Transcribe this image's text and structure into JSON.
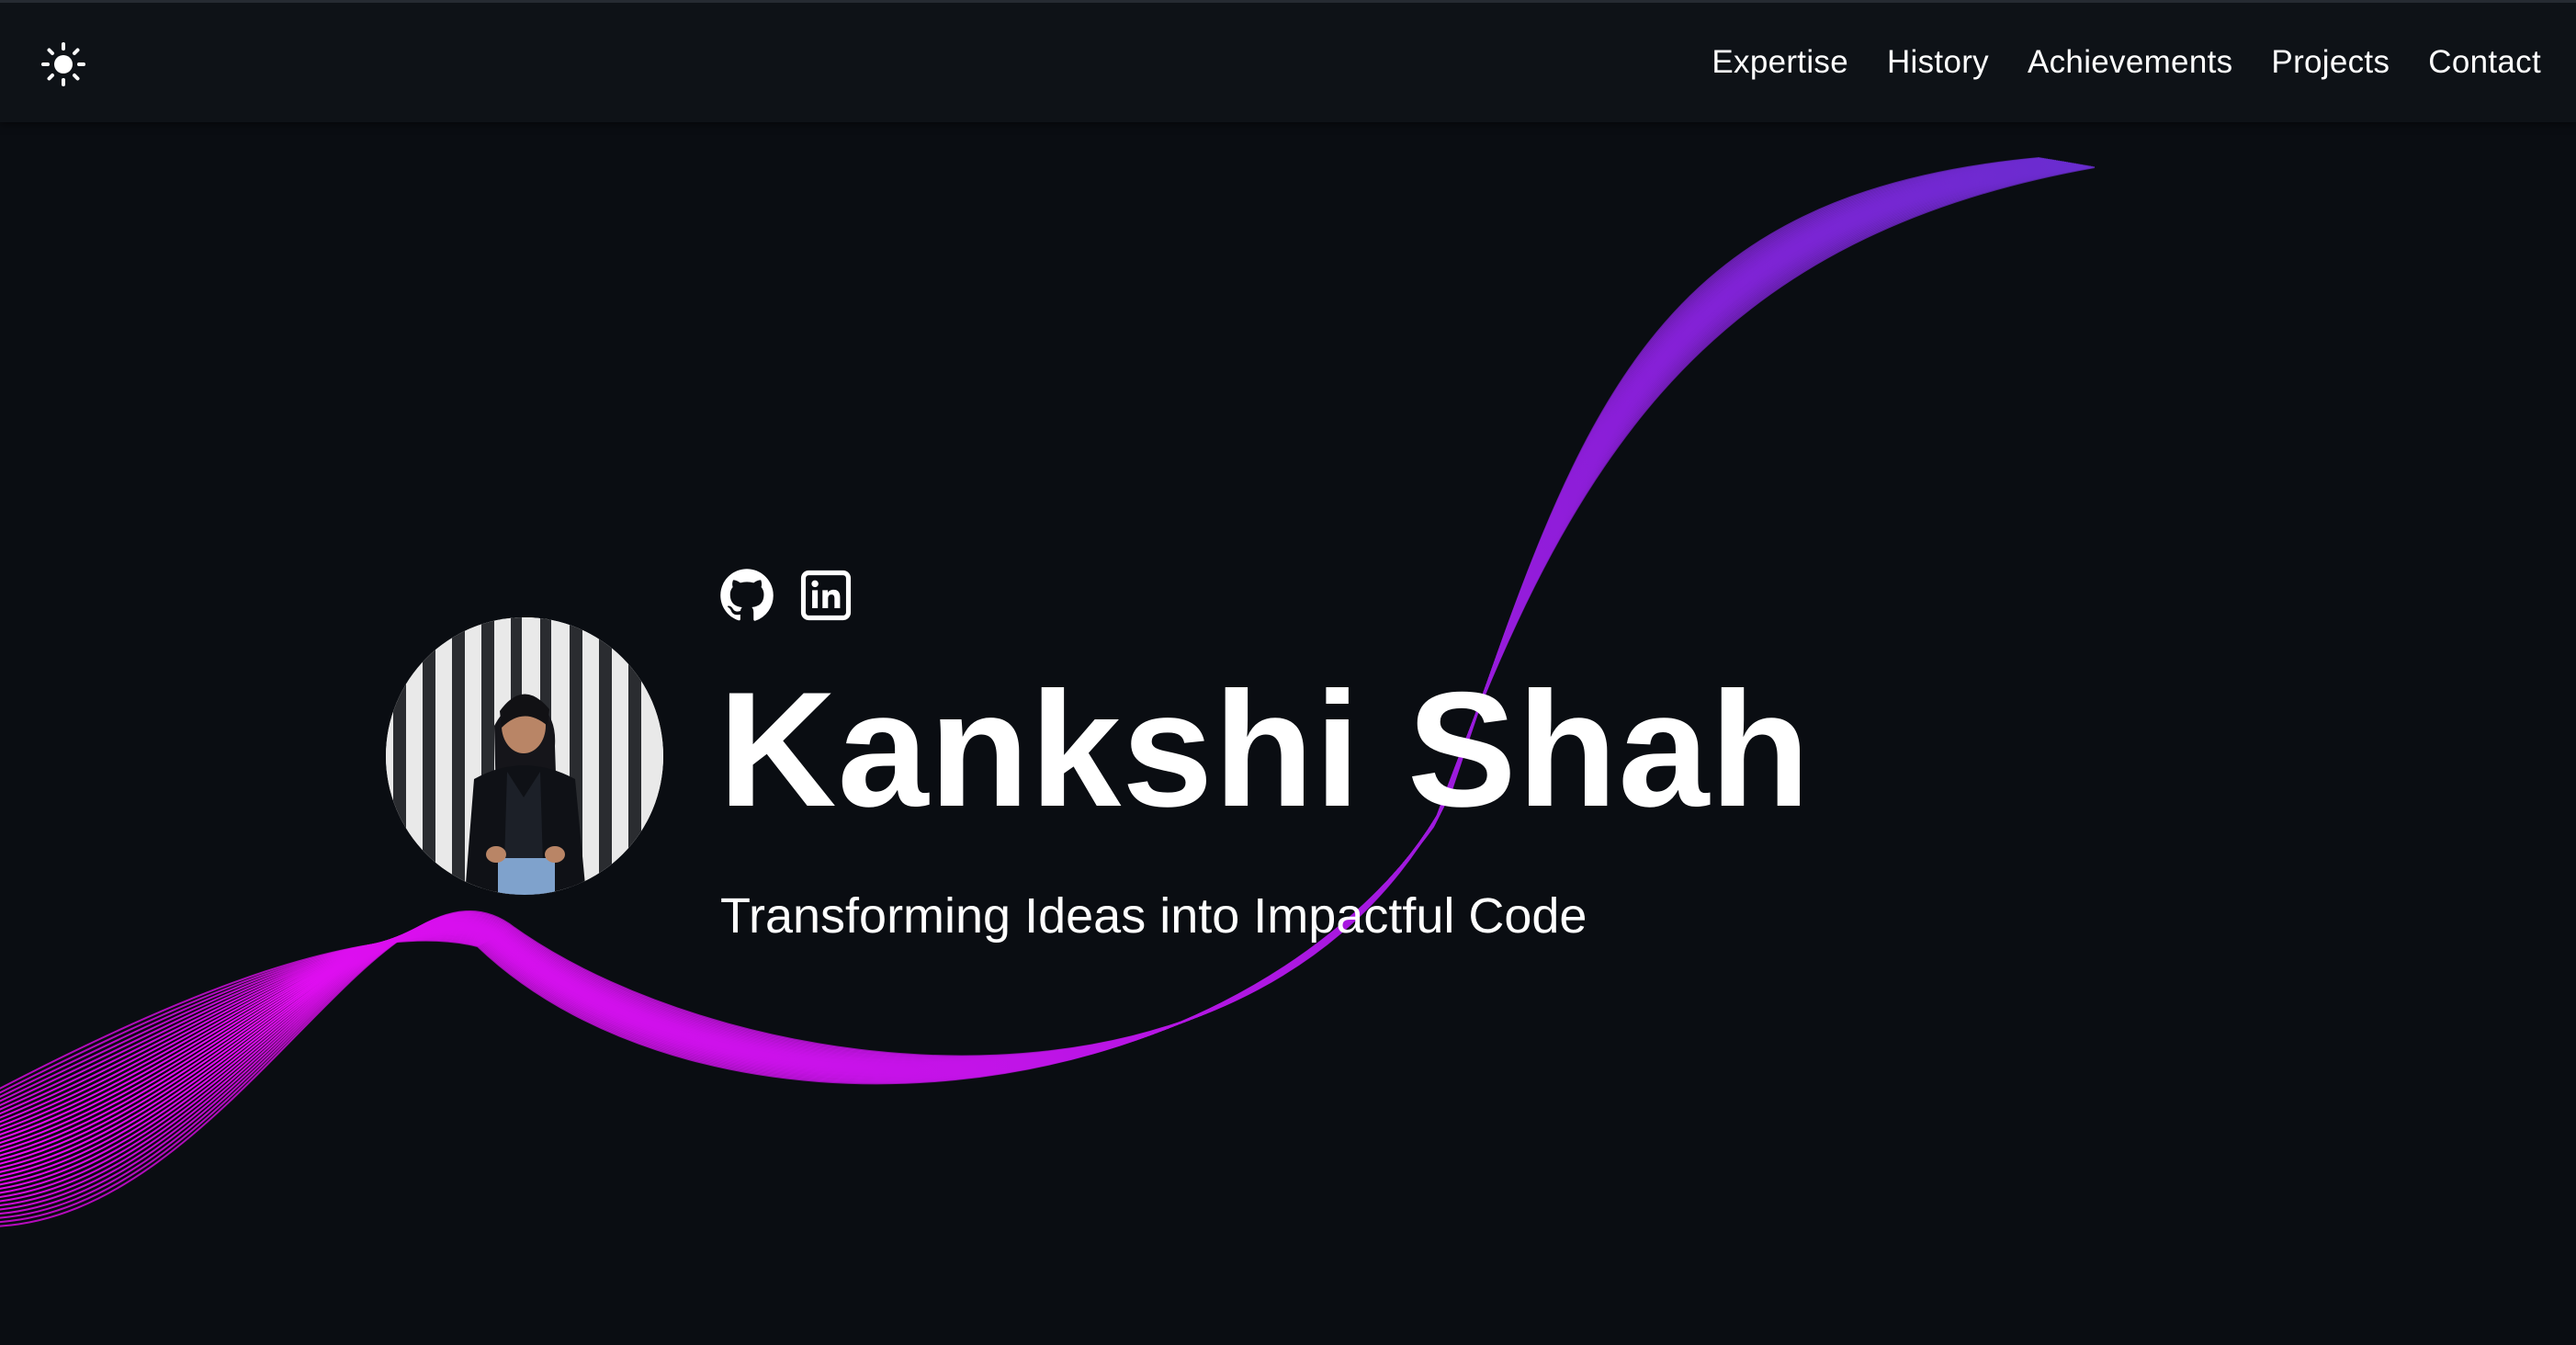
{
  "nav": {
    "theme_toggle_icon": "sun-icon",
    "links": [
      {
        "label": "Expertise"
      },
      {
        "label": "History"
      },
      {
        "label": "Achievements"
      },
      {
        "label": "Projects"
      },
      {
        "label": "Contact"
      }
    ]
  },
  "hero": {
    "name": "Kankshi Shah",
    "tagline": "Transforming Ideas into Impactful Code",
    "social_icons": [
      "github-icon",
      "linkedin-icon"
    ],
    "avatar_icon": "profile-photo"
  },
  "colors": {
    "background": "#0a0d12",
    "navbar": "#0e1217",
    "wave_magenta": "#e40bf0",
    "wave_purple": "#8a1ed8",
    "wave_indigo": "#5b34c9",
    "text": "#ffffff"
  }
}
